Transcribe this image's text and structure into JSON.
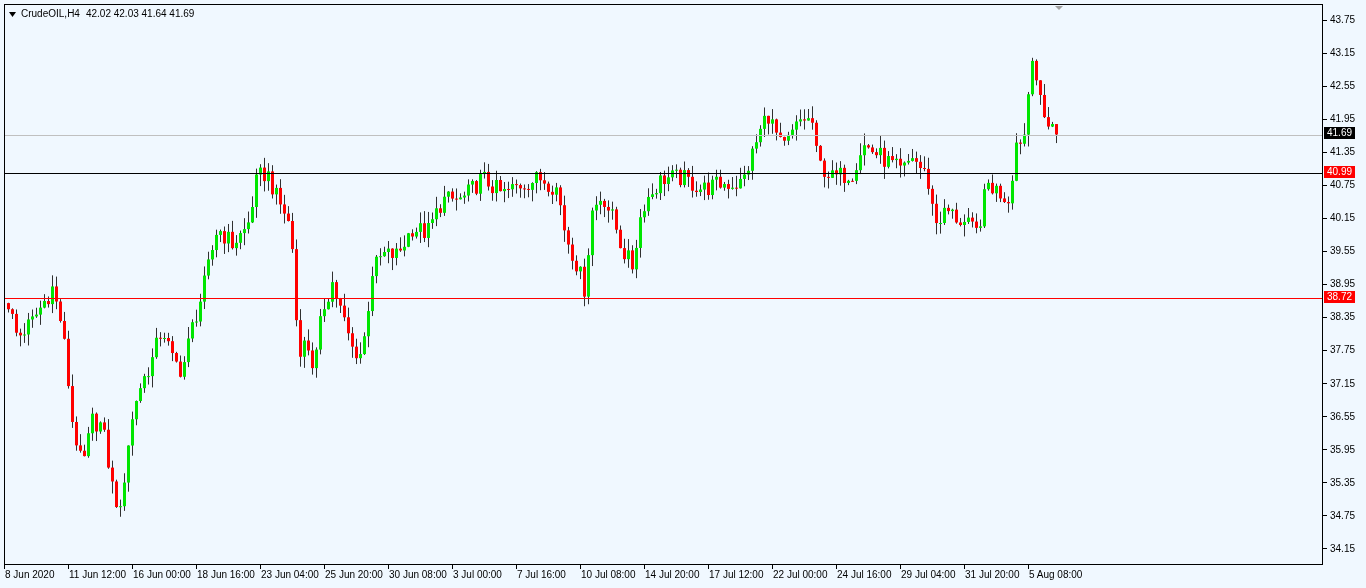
{
  "header": {
    "symbol": "CrudeOIL,H4",
    "quote": "42.02 42.03 41.64 41.69"
  },
  "price_axis": {
    "labels": [
      "43.75",
      "43.15",
      "42.55",
      "41.95",
      "41.35",
      "40.75",
      "40.15",
      "39.55",
      "38.95",
      "38.35",
      "37.75",
      "37.15",
      "36.55",
      "35.95",
      "35.35",
      "34.75",
      "34.15"
    ]
  },
  "levels": [
    {
      "price": "41.69",
      "kind": "price",
      "color": "#c0c0c0"
    },
    {
      "price": "40.99",
      "kind": "alert",
      "color": "#000000"
    },
    {
      "price": "38.72",
      "kind": "alert",
      "color": "#ff0000"
    }
  ],
  "time_axis": {
    "labels": [
      "8 Jun 2020",
      "11 Jun 12:00",
      "16 Jun 00:00",
      "18 Jun 16:00",
      "23 Jun 04:00",
      "25 Jun 20:00",
      "30 Jun 08:00",
      "3 Jul 00:00",
      "7 Jul 16:00",
      "10 Jul 08:00",
      "14 Jul 20:00",
      "17 Jul 12:00",
      "22 Jul 00:00",
      "24 Jul 16:00",
      "29 Jul 04:00",
      "31 Jul 20:00",
      "5 Aug 08:00"
    ]
  }
}
